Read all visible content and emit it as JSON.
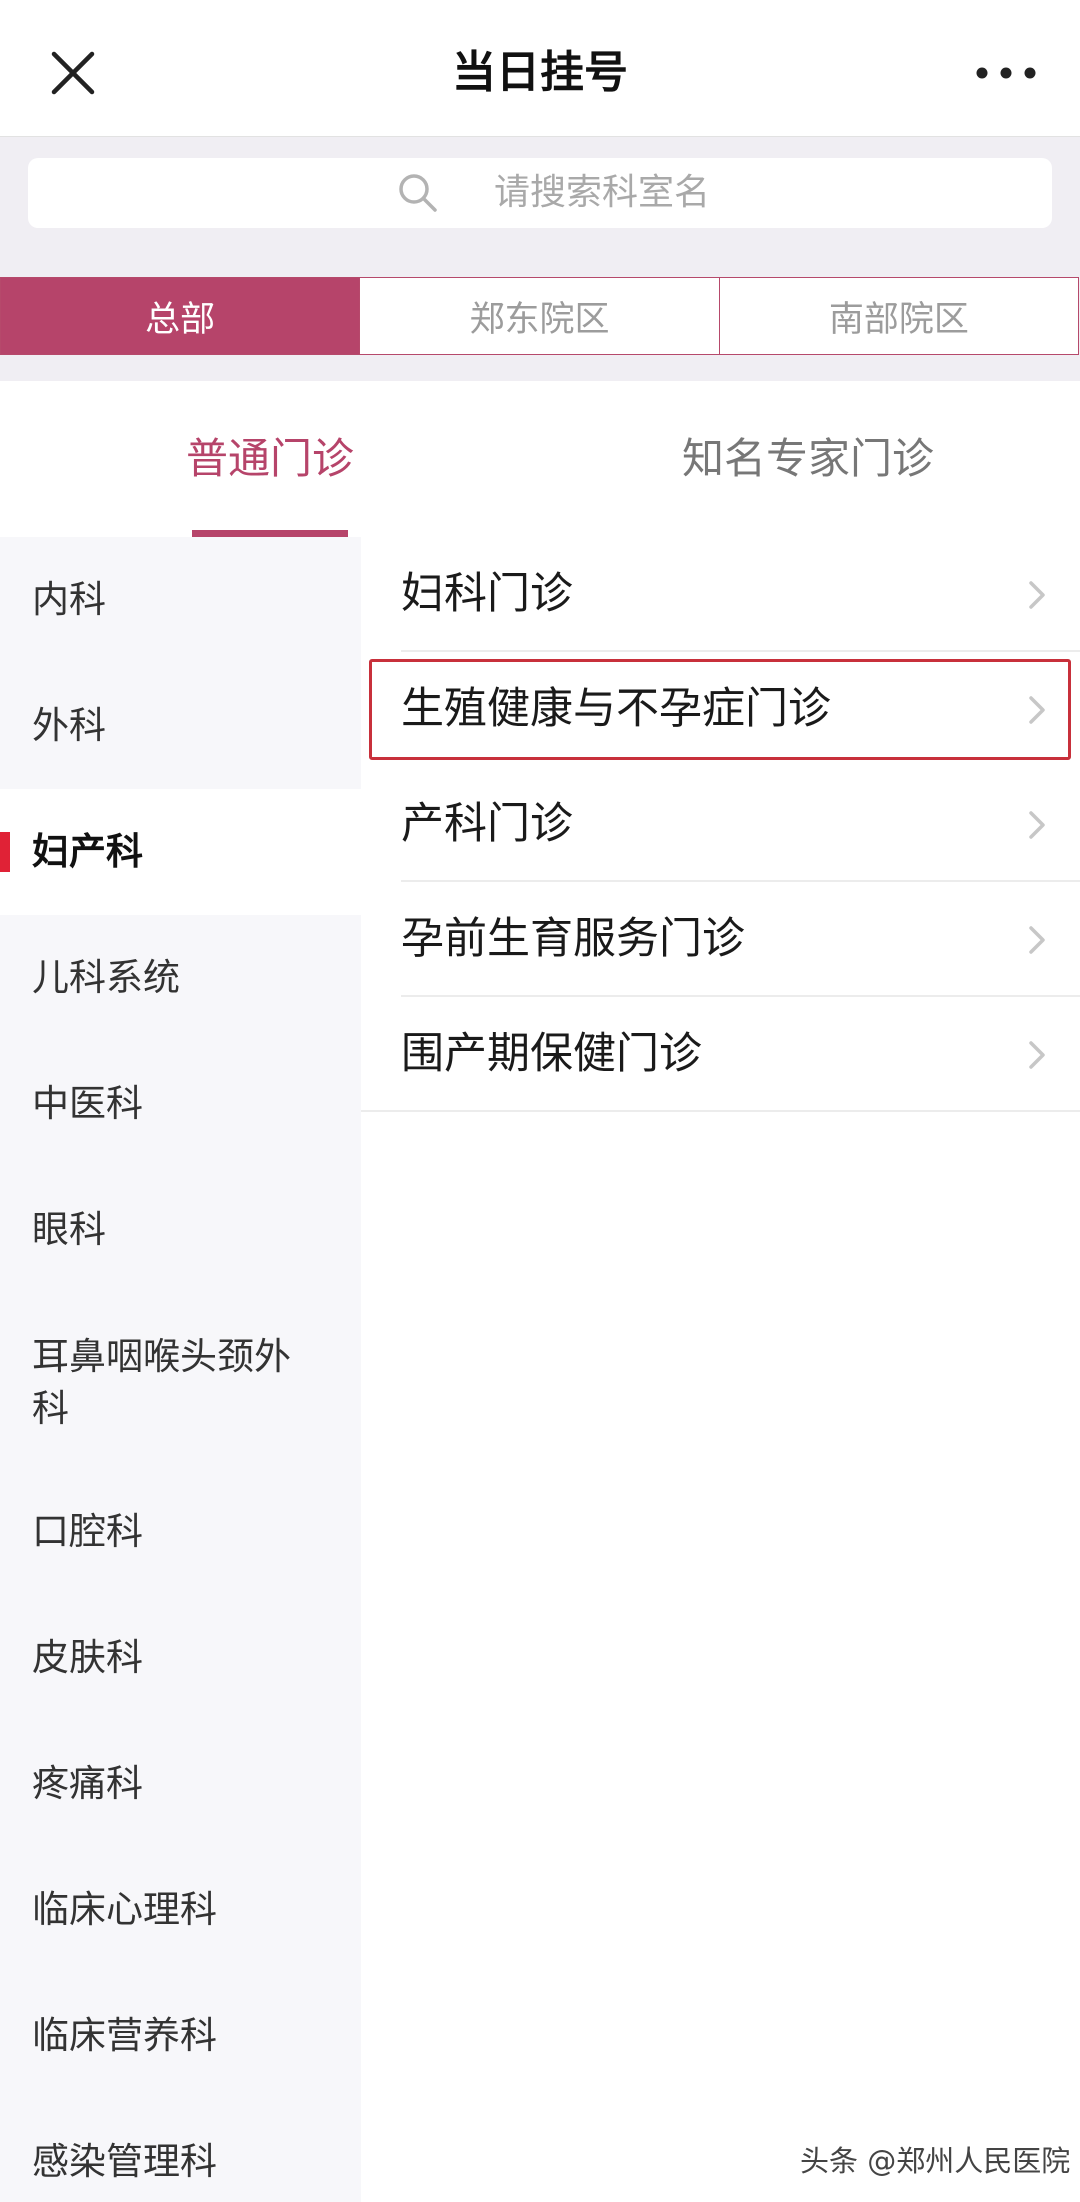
{
  "header": {
    "title": "当日挂号",
    "close_icon": "close-icon",
    "more_icon": "more-horizontal-icon"
  },
  "search": {
    "placeholder": "请搜索科室名",
    "icon": "search-icon"
  },
  "campus_tabs": [
    {
      "label": "总部",
      "active": true
    },
    {
      "label": "郑东院区",
      "active": false
    },
    {
      "label": "南部院区",
      "active": false
    }
  ],
  "clinic_type_tabs": [
    {
      "label": "普通门诊",
      "active": true
    },
    {
      "label": "知名专家门诊",
      "active": false
    }
  ],
  "departments": [
    {
      "label": "内科"
    },
    {
      "label": "外科"
    },
    {
      "label": "妇产科",
      "active": true
    },
    {
      "label": "儿科系统"
    },
    {
      "label": "中医科"
    },
    {
      "label": "眼科"
    },
    {
      "label": "耳鼻咽喉头颈外",
      "label_line2": "科"
    },
    {
      "label": "口腔科"
    },
    {
      "label": "皮肤科"
    },
    {
      "label": "疼痛科"
    },
    {
      "label": "临床心理科"
    },
    {
      "label": "临床营养科"
    },
    {
      "label": "感染管理科"
    }
  ],
  "clinics": [
    {
      "label": "妇科门诊"
    },
    {
      "label": "生殖健康与不孕症门诊",
      "highlighted": true
    },
    {
      "label": "产科门诊"
    },
    {
      "label": "孕前生育服务门诊"
    },
    {
      "label": "围产期保健门诊"
    }
  ],
  "watermark": "头条 @郑州人民医院",
  "colors": {
    "accent": "#b6446a",
    "active_marker": "#e02236",
    "highlight_border": "#c8303b",
    "band_background": "#f0eef3",
    "sidebar_background": "#f7f7fa"
  }
}
